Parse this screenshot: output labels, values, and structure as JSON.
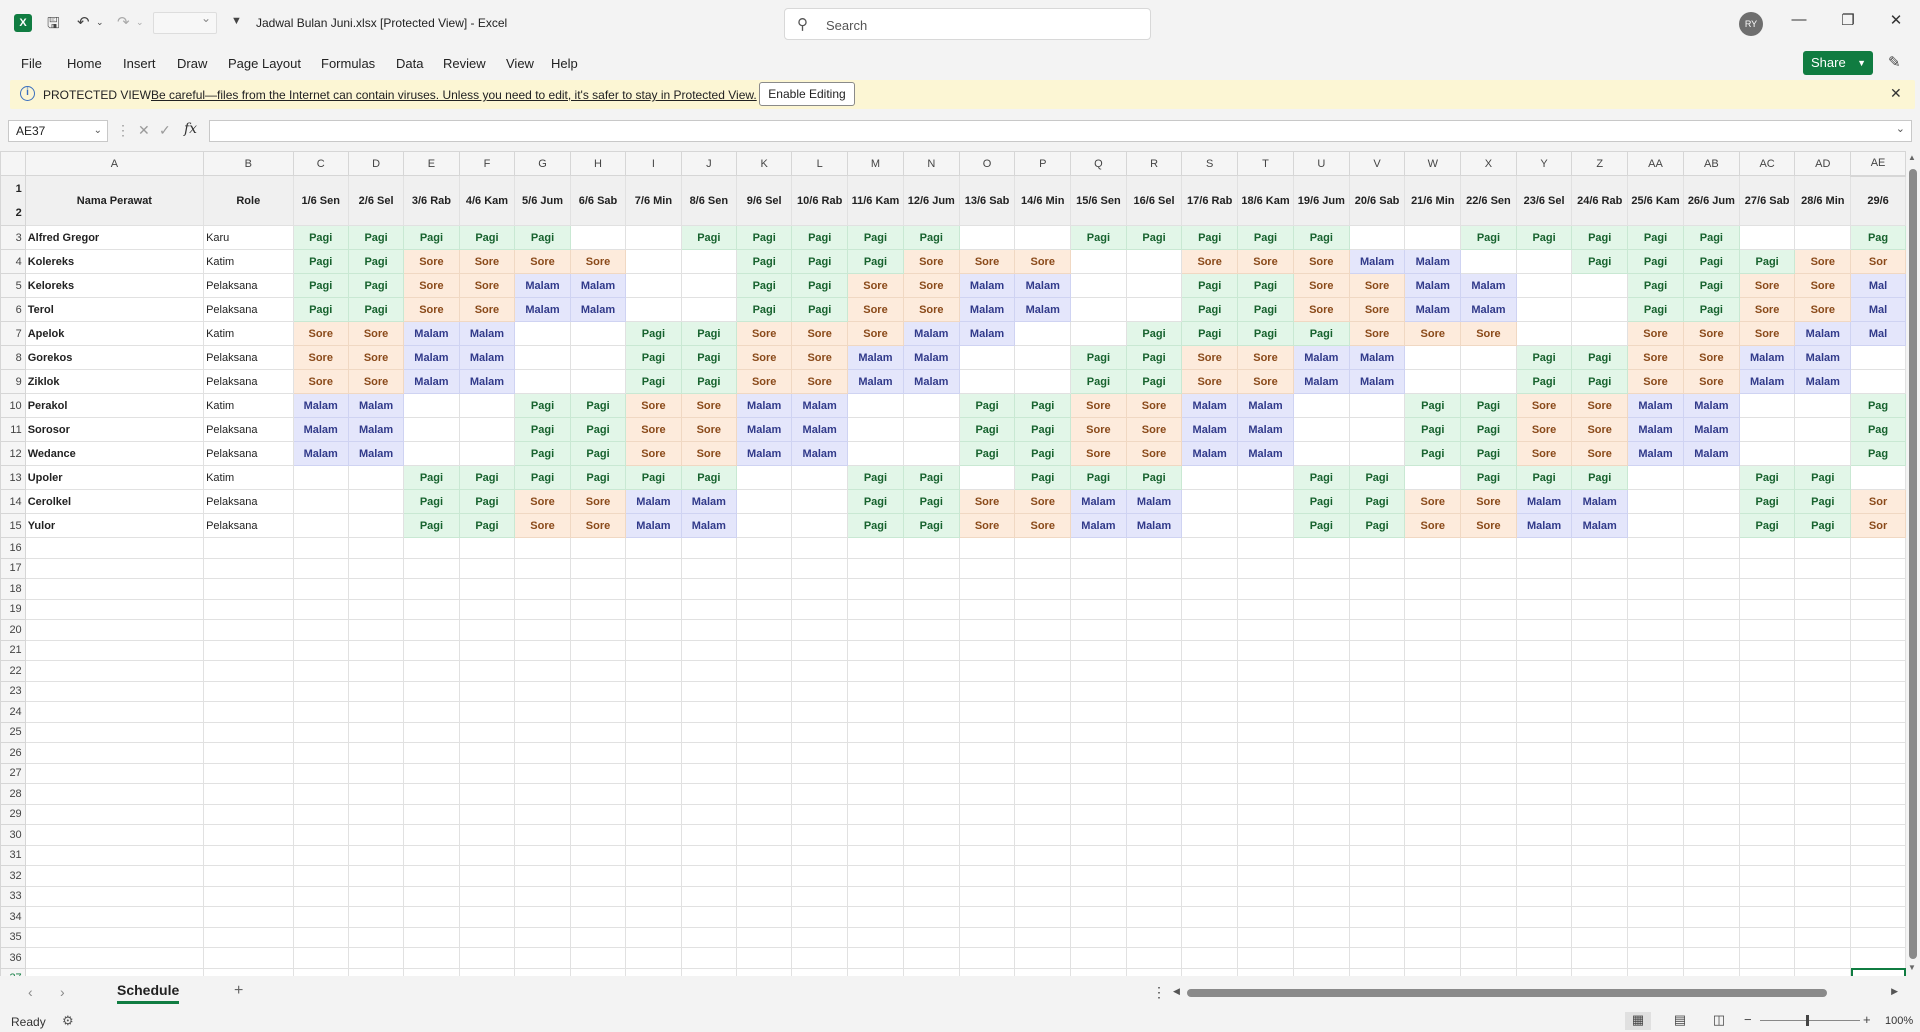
{
  "app": {
    "document_title": "Jadwal Bulan Juni.xlsx  [Protected View]  -  Excel",
    "search_placeholder": "Search",
    "user_initials": "RY"
  },
  "menu": [
    "File",
    "Home",
    "Insert",
    "Draw",
    "Page Layout",
    "Formulas",
    "Data",
    "Review",
    "View",
    "Help"
  ],
  "share_label": "Share",
  "protected_view": {
    "title": "PROTECTED VIEW",
    "message": "Be careful—files from the Internet can contain viruses. Unless you need to edit, it's safer to stay in Protected View.",
    "enable_button": "Enable Editing"
  },
  "formula_bar": {
    "name_box": "AE37",
    "fx": "fx",
    "value": ""
  },
  "grid": {
    "column_letters": [
      "A",
      "B",
      "C",
      "D",
      "E",
      "F",
      "G",
      "H",
      "I",
      "J",
      "K",
      "L",
      "M",
      "N",
      "O",
      "P",
      "Q",
      "R",
      "S",
      "T",
      "U",
      "V",
      "W",
      "X",
      "Y",
      "Z",
      "AA",
      "AB",
      "AC",
      "AD",
      "AE"
    ],
    "header_name": "Nama Perawat",
    "header_role": "Role",
    "dates": [
      "1/6 Sen",
      "2/6 Sel",
      "3/6 Rab",
      "4/6 Kam",
      "5/6 Jum",
      "6/6 Sab",
      "7/6 Min",
      "8/6 Sen",
      "9/6 Sel",
      "10/6 Rab",
      "11/6 Kam",
      "12/6 Jum",
      "13/6 Sab",
      "14/6 Min",
      "15/6 Sen",
      "16/6 Sel",
      "17/6 Rab",
      "18/6 Kam",
      "19/6 Jum",
      "20/6 Sab",
      "21/6 Min",
      "22/6 Sen",
      "23/6 Sel",
      "24/6 Rab",
      "25/6 Kam",
      "26/6 Jum",
      "27/6 Sab",
      "28/6 Min",
      "29/6"
    ],
    "rows": [
      {
        "name": "Alfred Gregor",
        "role": "Karu",
        "shifts": [
          "Pagi",
          "Pagi",
          "Pagi",
          "Pagi",
          "Pagi",
          "",
          "",
          "Pagi",
          "Pagi",
          "Pagi",
          "Pagi",
          "Pagi",
          "",
          "",
          "Pagi",
          "Pagi",
          "Pagi",
          "Pagi",
          "Pagi",
          "",
          "",
          "Pagi",
          "Pagi",
          "Pagi",
          "Pagi",
          "Pagi",
          "",
          "",
          "Pag"
        ]
      },
      {
        "name": "Kolereks",
        "role": "Katim",
        "shifts": [
          "Pagi",
          "Pagi",
          "Sore",
          "Sore",
          "Sore",
          "Sore",
          "",
          "",
          "Pagi",
          "Pagi",
          "Pagi",
          "Sore",
          "Sore",
          "Sore",
          "",
          "",
          "Sore",
          "Sore",
          "Sore",
          "Malam",
          "Malam",
          "",
          "",
          "Pagi",
          "Pagi",
          "Pagi",
          "Pagi",
          "Sore",
          "Sor"
        ]
      },
      {
        "name": "Keloreks",
        "role": "Pelaksana",
        "shifts": [
          "Pagi",
          "Pagi",
          "Sore",
          "Sore",
          "Malam",
          "Malam",
          "",
          "",
          "Pagi",
          "Pagi",
          "Sore",
          "Sore",
          "Malam",
          "Malam",
          "",
          "",
          "Pagi",
          "Pagi",
          "Sore",
          "Sore",
          "Malam",
          "Malam",
          "",
          "",
          "Pagi",
          "Pagi",
          "Sore",
          "Sore",
          "Mal"
        ]
      },
      {
        "name": "Terol",
        "role": "Pelaksana",
        "shifts": [
          "Pagi",
          "Pagi",
          "Sore",
          "Sore",
          "Malam",
          "Malam",
          "",
          "",
          "Pagi",
          "Pagi",
          "Sore",
          "Sore",
          "Malam",
          "Malam",
          "",
          "",
          "Pagi",
          "Pagi",
          "Sore",
          "Sore",
          "Malam",
          "Malam",
          "",
          "",
          "Pagi",
          "Pagi",
          "Sore",
          "Sore",
          "Mal"
        ]
      },
      {
        "name": "Apelok",
        "role": "Katim",
        "shifts": [
          "Sore",
          "Sore",
          "Malam",
          "Malam",
          "",
          "",
          "Pagi",
          "Pagi",
          "Sore",
          "Sore",
          "Sore",
          "Malam",
          "Malam",
          "",
          "",
          "Pagi",
          "Pagi",
          "Pagi",
          "Pagi",
          "Sore",
          "Sore",
          "Sore",
          "",
          "",
          "Sore",
          "Sore",
          "Sore",
          "Malam",
          "Mal"
        ]
      },
      {
        "name": "Gorekos",
        "role": "Pelaksana",
        "shifts": [
          "Sore",
          "Sore",
          "Malam",
          "Malam",
          "",
          "",
          "Pagi",
          "Pagi",
          "Sore",
          "Sore",
          "Malam",
          "Malam",
          "",
          "",
          "Pagi",
          "Pagi",
          "Sore",
          "Sore",
          "Malam",
          "Malam",
          "",
          "",
          "Pagi",
          "Pagi",
          "Sore",
          "Sore",
          "Malam",
          "Malam",
          ""
        ]
      },
      {
        "name": "Ziklok",
        "role": "Pelaksana",
        "shifts": [
          "Sore",
          "Sore",
          "Malam",
          "Malam",
          "",
          "",
          "Pagi",
          "Pagi",
          "Sore",
          "Sore",
          "Malam",
          "Malam",
          "",
          "",
          "Pagi",
          "Pagi",
          "Sore",
          "Sore",
          "Malam",
          "Malam",
          "",
          "",
          "Pagi",
          "Pagi",
          "Sore",
          "Sore",
          "Malam",
          "Malam",
          ""
        ]
      },
      {
        "name": "Perakol",
        "role": "Katim",
        "shifts": [
          "Malam",
          "Malam",
          "",
          "",
          "Pagi",
          "Pagi",
          "Sore",
          "Sore",
          "Malam",
          "Malam",
          "",
          "",
          "Pagi",
          "Pagi",
          "Sore",
          "Sore",
          "Malam",
          "Malam",
          "",
          "",
          "Pagi",
          "Pagi",
          "Sore",
          "Sore",
          "Malam",
          "Malam",
          "",
          "",
          "Pag"
        ]
      },
      {
        "name": "Sorosor",
        "role": "Pelaksana",
        "shifts": [
          "Malam",
          "Malam",
          "",
          "",
          "Pagi",
          "Pagi",
          "Sore",
          "Sore",
          "Malam",
          "Malam",
          "",
          "",
          "Pagi",
          "Pagi",
          "Sore",
          "Sore",
          "Malam",
          "Malam",
          "",
          "",
          "Pagi",
          "Pagi",
          "Sore",
          "Sore",
          "Malam",
          "Malam",
          "",
          "",
          "Pag"
        ]
      },
      {
        "name": "Wedance",
        "role": "Pelaksana",
        "shifts": [
          "Malam",
          "Malam",
          "",
          "",
          "Pagi",
          "Pagi",
          "Sore",
          "Sore",
          "Malam",
          "Malam",
          "",
          "",
          "Pagi",
          "Pagi",
          "Sore",
          "Sore",
          "Malam",
          "Malam",
          "",
          "",
          "Pagi",
          "Pagi",
          "Sore",
          "Sore",
          "Malam",
          "Malam",
          "",
          "",
          "Pag"
        ]
      },
      {
        "name": "Upoler",
        "role": "Katim",
        "shifts": [
          "",
          "",
          "Pagi",
          "Pagi",
          "Pagi",
          "Pagi",
          "Pagi",
          "Pagi",
          "",
          "",
          "Pagi",
          "Pagi",
          "",
          "Pagi",
          "Pagi",
          "Pagi",
          "",
          "",
          "Pagi",
          "Pagi",
          "",
          "Pagi",
          "Pagi",
          "Pagi",
          "",
          "",
          "Pagi",
          "Pagi",
          ""
        ]
      },
      {
        "name": "Cerolkel",
        "role": "Pelaksana",
        "shifts": [
          "",
          "",
          "Pagi",
          "Pagi",
          "Sore",
          "Sore",
          "Malam",
          "Malam",
          "",
          "",
          "Pagi",
          "Pagi",
          "Sore",
          "Sore",
          "Malam",
          "Malam",
          "",
          "",
          "Pagi",
          "Pagi",
          "Sore",
          "Sore",
          "Malam",
          "Malam",
          "",
          "",
          "Pagi",
          "Pagi",
          "Sor"
        ]
      },
      {
        "name": "Yulor",
        "role": "Pelaksana",
        "shifts": [
          "",
          "",
          "Pagi",
          "Pagi",
          "Sore",
          "Sore",
          "Malam",
          "Malam",
          "",
          "",
          "Pagi",
          "Pagi",
          "Sore",
          "Sore",
          "Malam",
          "Malam",
          "",
          "",
          "Pagi",
          "Pagi",
          "Sore",
          "Sore",
          "Malam",
          "Malam",
          "",
          "",
          "Pagi",
          "Pagi",
          "Sor"
        ]
      }
    ],
    "empty_rows": [
      16,
      17,
      18,
      19,
      20,
      21,
      22,
      23,
      24,
      25,
      26,
      27,
      28,
      29,
      30,
      31,
      32,
      33,
      34,
      35,
      36,
      37
    ],
    "active_cell": "AE37"
  },
  "sheet_tabs": {
    "active": "Schedule"
  },
  "status": {
    "ready": "Ready",
    "zoom": "100%"
  },
  "colors": {
    "pagi_bg": "#e2f6e8",
    "sore_bg": "#fdebdc",
    "malam_bg": "#e4e6fb",
    "accent": "#107c41",
    "protected_bg": "#fcf6d4"
  }
}
